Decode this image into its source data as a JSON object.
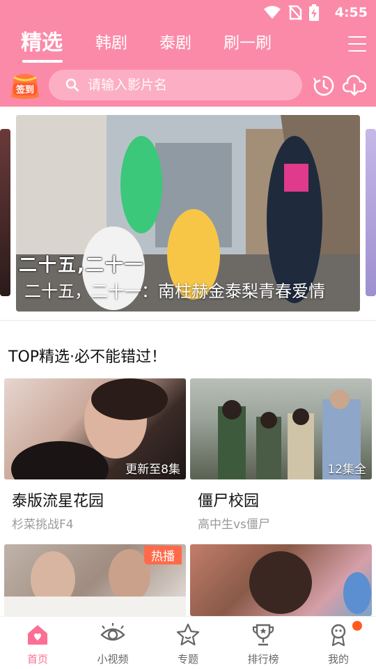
{
  "status": {
    "time": "4:55"
  },
  "tabs": [
    {
      "label": "精选",
      "active": true
    },
    {
      "label": "韩剧",
      "active": false
    },
    {
      "label": "泰剧",
      "active": false
    },
    {
      "label": "刷一刷",
      "active": false
    }
  ],
  "search": {
    "placeholder": "请输入影片名",
    "value": "",
    "signin_label": "签到"
  },
  "banner": {
    "overlay_text": "二十五,二十一",
    "caption": "二十五，二十一：南柱赫金泰梨青春爱情"
  },
  "section": {
    "title": "TOP精选·必不能错过！"
  },
  "cards": [
    {
      "title": "泰版流星花园",
      "subtitle": "杉菜挑战F4",
      "badge": "更新至8集",
      "tag": ""
    },
    {
      "title": "僵尸校园",
      "subtitle": "高中生vs僵尸",
      "badge": "12集全",
      "tag": ""
    },
    {
      "title": "",
      "subtitle": "",
      "badge": "",
      "tag": "热播"
    },
    {
      "title": "",
      "subtitle": "",
      "badge": "",
      "tag": ""
    }
  ],
  "bottom_nav": [
    {
      "label": "首页",
      "icon": "home-icon",
      "active": true
    },
    {
      "label": "小视频",
      "icon": "eye-icon",
      "active": false
    },
    {
      "label": "专题",
      "icon": "star-icon",
      "active": false
    },
    {
      "label": "排行榜",
      "icon": "trophy-icon",
      "active": false
    },
    {
      "label": "我的",
      "icon": "profile-icon",
      "active": false,
      "has_dot": true
    }
  ],
  "colors": {
    "brand": "#fb8aa8",
    "active_nav": "#fb6f95",
    "hot_tag": "#ff6b4a",
    "dot": "#ff5a1f"
  }
}
